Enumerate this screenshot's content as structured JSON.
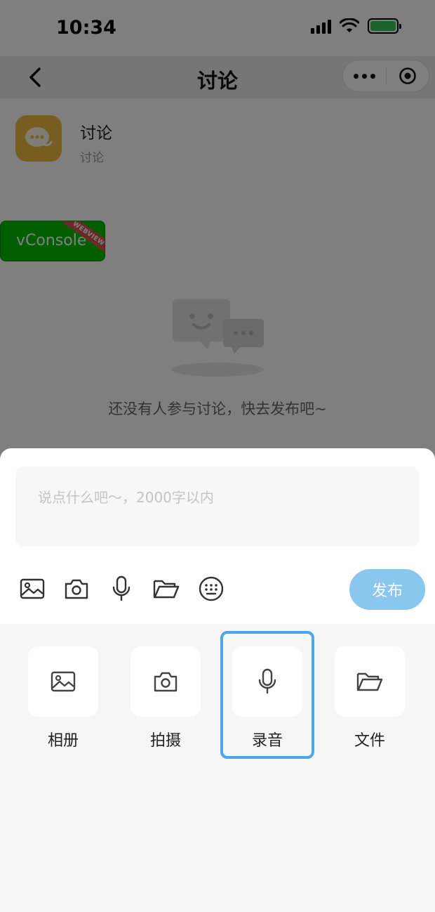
{
  "status_bar": {
    "time": "10:34"
  },
  "nav": {
    "title": "讨论"
  },
  "header": {
    "title": "讨论",
    "subtitle": "讨论"
  },
  "vconsole": {
    "label": "vConsole",
    "badge": "WEBVIEW"
  },
  "empty_state": {
    "text": "还没有人参与讨论，快去发布吧~"
  },
  "composer": {
    "placeholder": "说点什么吧～，2000字以内",
    "value": "",
    "publish_label": "发布",
    "toolbar_icons": [
      "image-icon",
      "camera-icon",
      "microphone-icon",
      "folder-icon",
      "keyboard-icon"
    ]
  },
  "attach_panel": {
    "items": [
      {
        "label": "相册",
        "icon": "image-icon"
      },
      {
        "label": "拍摄",
        "icon": "camera-icon"
      },
      {
        "label": "录音",
        "icon": "microphone-icon",
        "selected": true
      },
      {
        "label": "文件",
        "icon": "folder-icon"
      }
    ]
  },
  "colors": {
    "accent": "#89c7ee",
    "highlight": "#4da6e8",
    "app_icon": "#f1bb43",
    "vconsole": "#04be02",
    "battery": "#34c759"
  }
}
